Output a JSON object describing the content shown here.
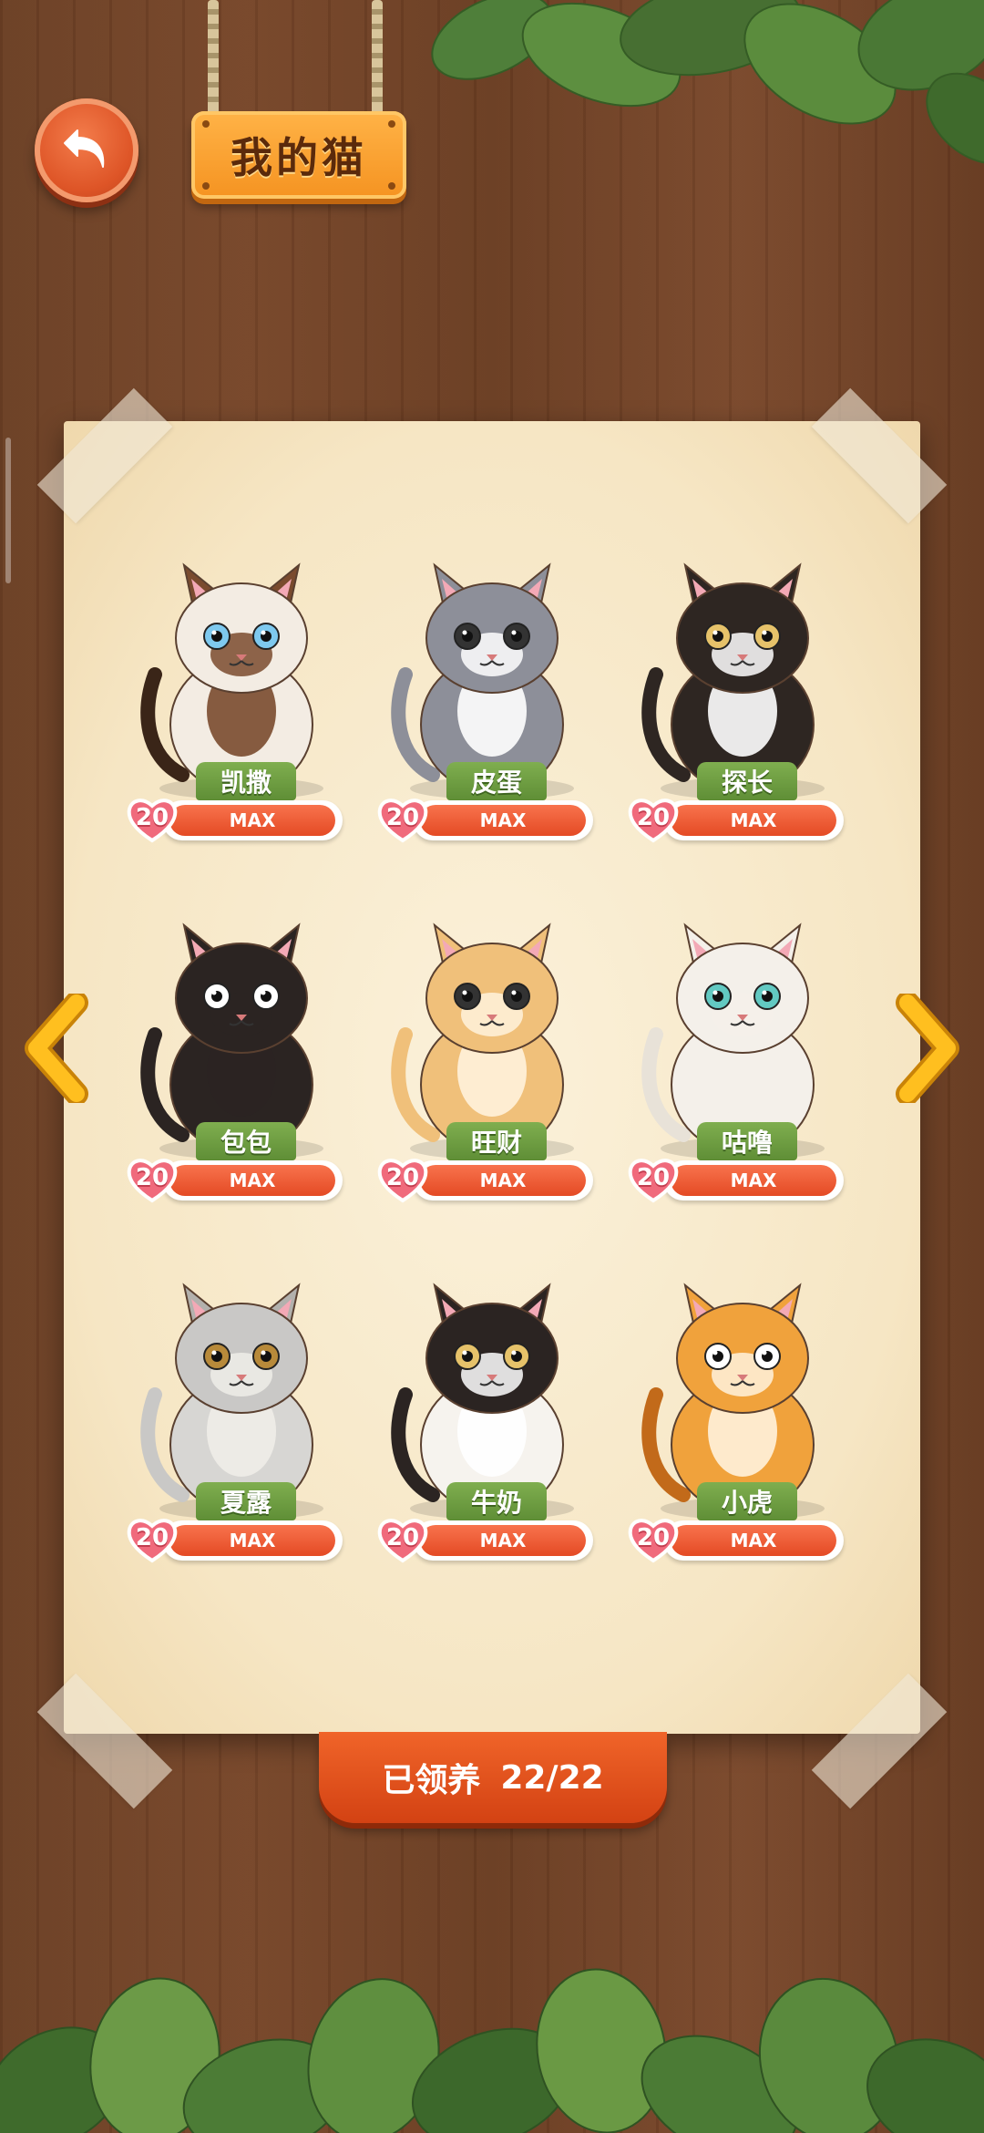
{
  "header": {
    "title": "我的猫"
  },
  "colors": {
    "accent": "#e44a24",
    "nameTag": "#6f9e43",
    "paper": "#f8ebcc",
    "wood": "#6e4126"
  },
  "cats": [
    {
      "name": "凯撒",
      "level": "20",
      "status": "MAX",
      "art": "siamese"
    },
    {
      "name": "皮蛋",
      "level": "20",
      "status": "MAX",
      "art": "grey-white"
    },
    {
      "name": "探长",
      "level": "20",
      "status": "MAX",
      "art": "black-mustache"
    },
    {
      "name": "包包",
      "level": "20",
      "status": "MAX",
      "art": "black-moon"
    },
    {
      "name": "旺财",
      "level": "20",
      "status": "MAX",
      "art": "orange-chubby"
    },
    {
      "name": "咕噜",
      "level": "20",
      "status": "MAX",
      "art": "white-odd-eye"
    },
    {
      "name": "夏露",
      "level": "20",
      "status": "MAX",
      "art": "grey-fold"
    },
    {
      "name": "牛奶",
      "level": "20",
      "status": "MAX",
      "art": "cow-pattern"
    },
    {
      "name": "小虎",
      "level": "20",
      "status": "MAX",
      "art": "tiger"
    }
  ],
  "footer": {
    "label": "已领养",
    "count": "22/22"
  }
}
